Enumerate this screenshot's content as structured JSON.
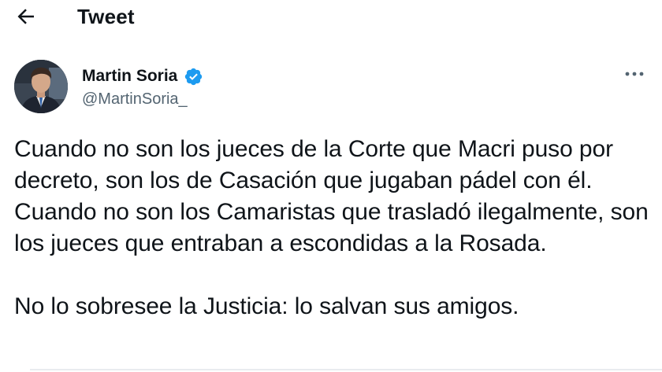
{
  "header": {
    "title": "Tweet",
    "back_icon": "arrow-left-icon"
  },
  "author": {
    "name": "Martin Soria",
    "handle": "@MartinSoria_",
    "verified_icon": "verified-badge-icon",
    "verified_color": "#1d9bf0"
  },
  "more_icon": "ellipsis-icon",
  "tweet": {
    "paragraph1": "Cuando no son los jueces de la Corte que Macri puso por decreto, son los de Casación que jugaban pádel con él. Cuando no son los Camaristas que trasladó ilegalmente, son los jueces que entraban a escondidas a la Rosada.",
    "paragraph2": "No lo sobresee la Justicia: lo salvan sus amigos."
  },
  "colors": {
    "text": "#0f1419",
    "secondary": "#536471",
    "accent": "#1d9bf0"
  }
}
